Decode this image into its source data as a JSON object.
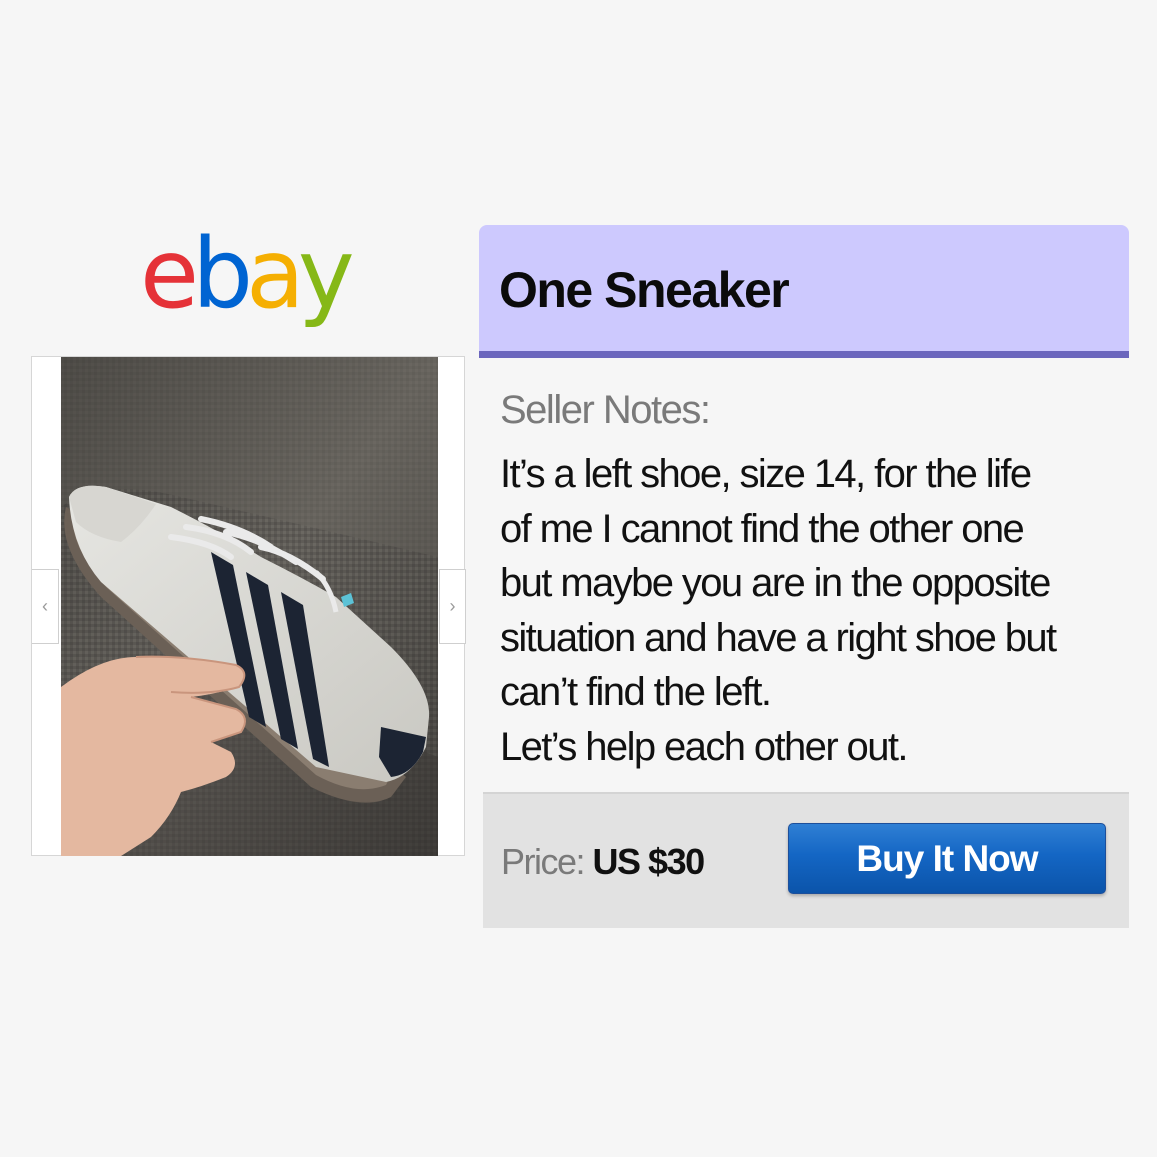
{
  "logo": {
    "letters": [
      {
        "char": "e",
        "color": "#e53238"
      },
      {
        "char": "b",
        "color": "#0064d2"
      },
      {
        "char": "a",
        "color": "#f5af02"
      },
      {
        "char": "y",
        "color": "#86b817"
      }
    ]
  },
  "gallery": {
    "prev_icon": "‹",
    "next_icon": "›"
  },
  "listing": {
    "title": "One Sneaker",
    "notes_label": "Seller Notes:",
    "notes_lines": [
      "It’s a left shoe, size 14, for the life",
      "of me I cannot find the other one",
      "but maybe you are in the opposite",
      "situation and have a right shoe but",
      "can’t find the left.",
      "Let’s help each other out."
    ]
  },
  "purchase": {
    "price_label": "Price:",
    "price_value": "US $30",
    "buy_label": "Buy It Now"
  }
}
